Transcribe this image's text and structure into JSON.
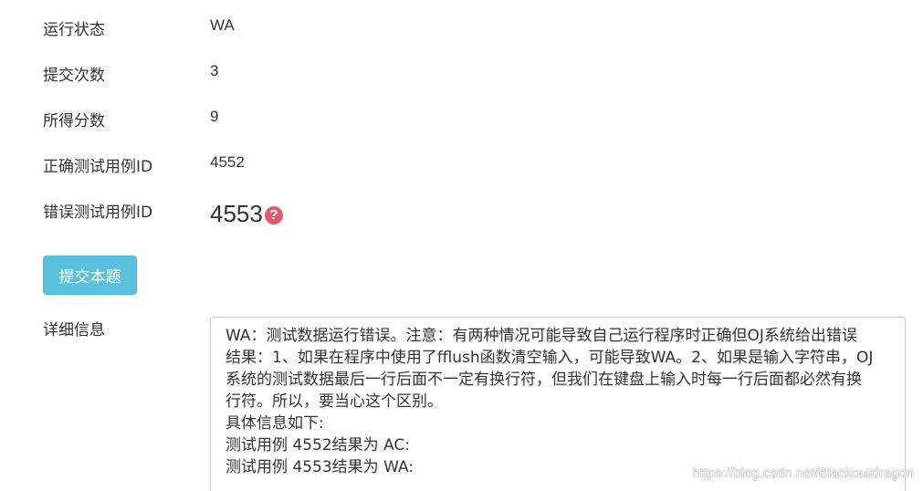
{
  "fields": {
    "status": {
      "label": "运行状态",
      "value": "WA"
    },
    "submit_count": {
      "label": "提交次数",
      "value": "3"
    },
    "score": {
      "label": "所得分数",
      "value": "9"
    },
    "correct_case": {
      "label": "正确测试用例ID",
      "value": "4552"
    },
    "wrong_case": {
      "label": "错误测试用例ID",
      "value": "4553",
      "icon": "question-circle-icon",
      "icon_glyph": "?"
    }
  },
  "submit_button": {
    "label": "提交本题"
  },
  "detail": {
    "label": "详细信息",
    "lines": [
      "WA：测试数据运行错误。注意：有两种情况可能导致自己运行程序时正确但OJ系统给出错误",
      "结果：1、如果在程序中使用了fflush函数清空输入，可能导致WA。2、如果是输入字符串，OJ",
      "系统的测试数据最后一行后面不一定有换行符，但我们在键盘上输入时每一行后面都必然有换",
      "行符。所以，要当心这个区别。",
      "具体信息如下:",
      "测试用例 4552结果为 AC:",
      "测试用例 4553结果为 WA:"
    ]
  },
  "watermark": "https://blog.csdn.net/Blackoutdragon",
  "colors": {
    "button": "#5bc0de",
    "help_icon": "#e05a6b",
    "text": "#333333"
  }
}
